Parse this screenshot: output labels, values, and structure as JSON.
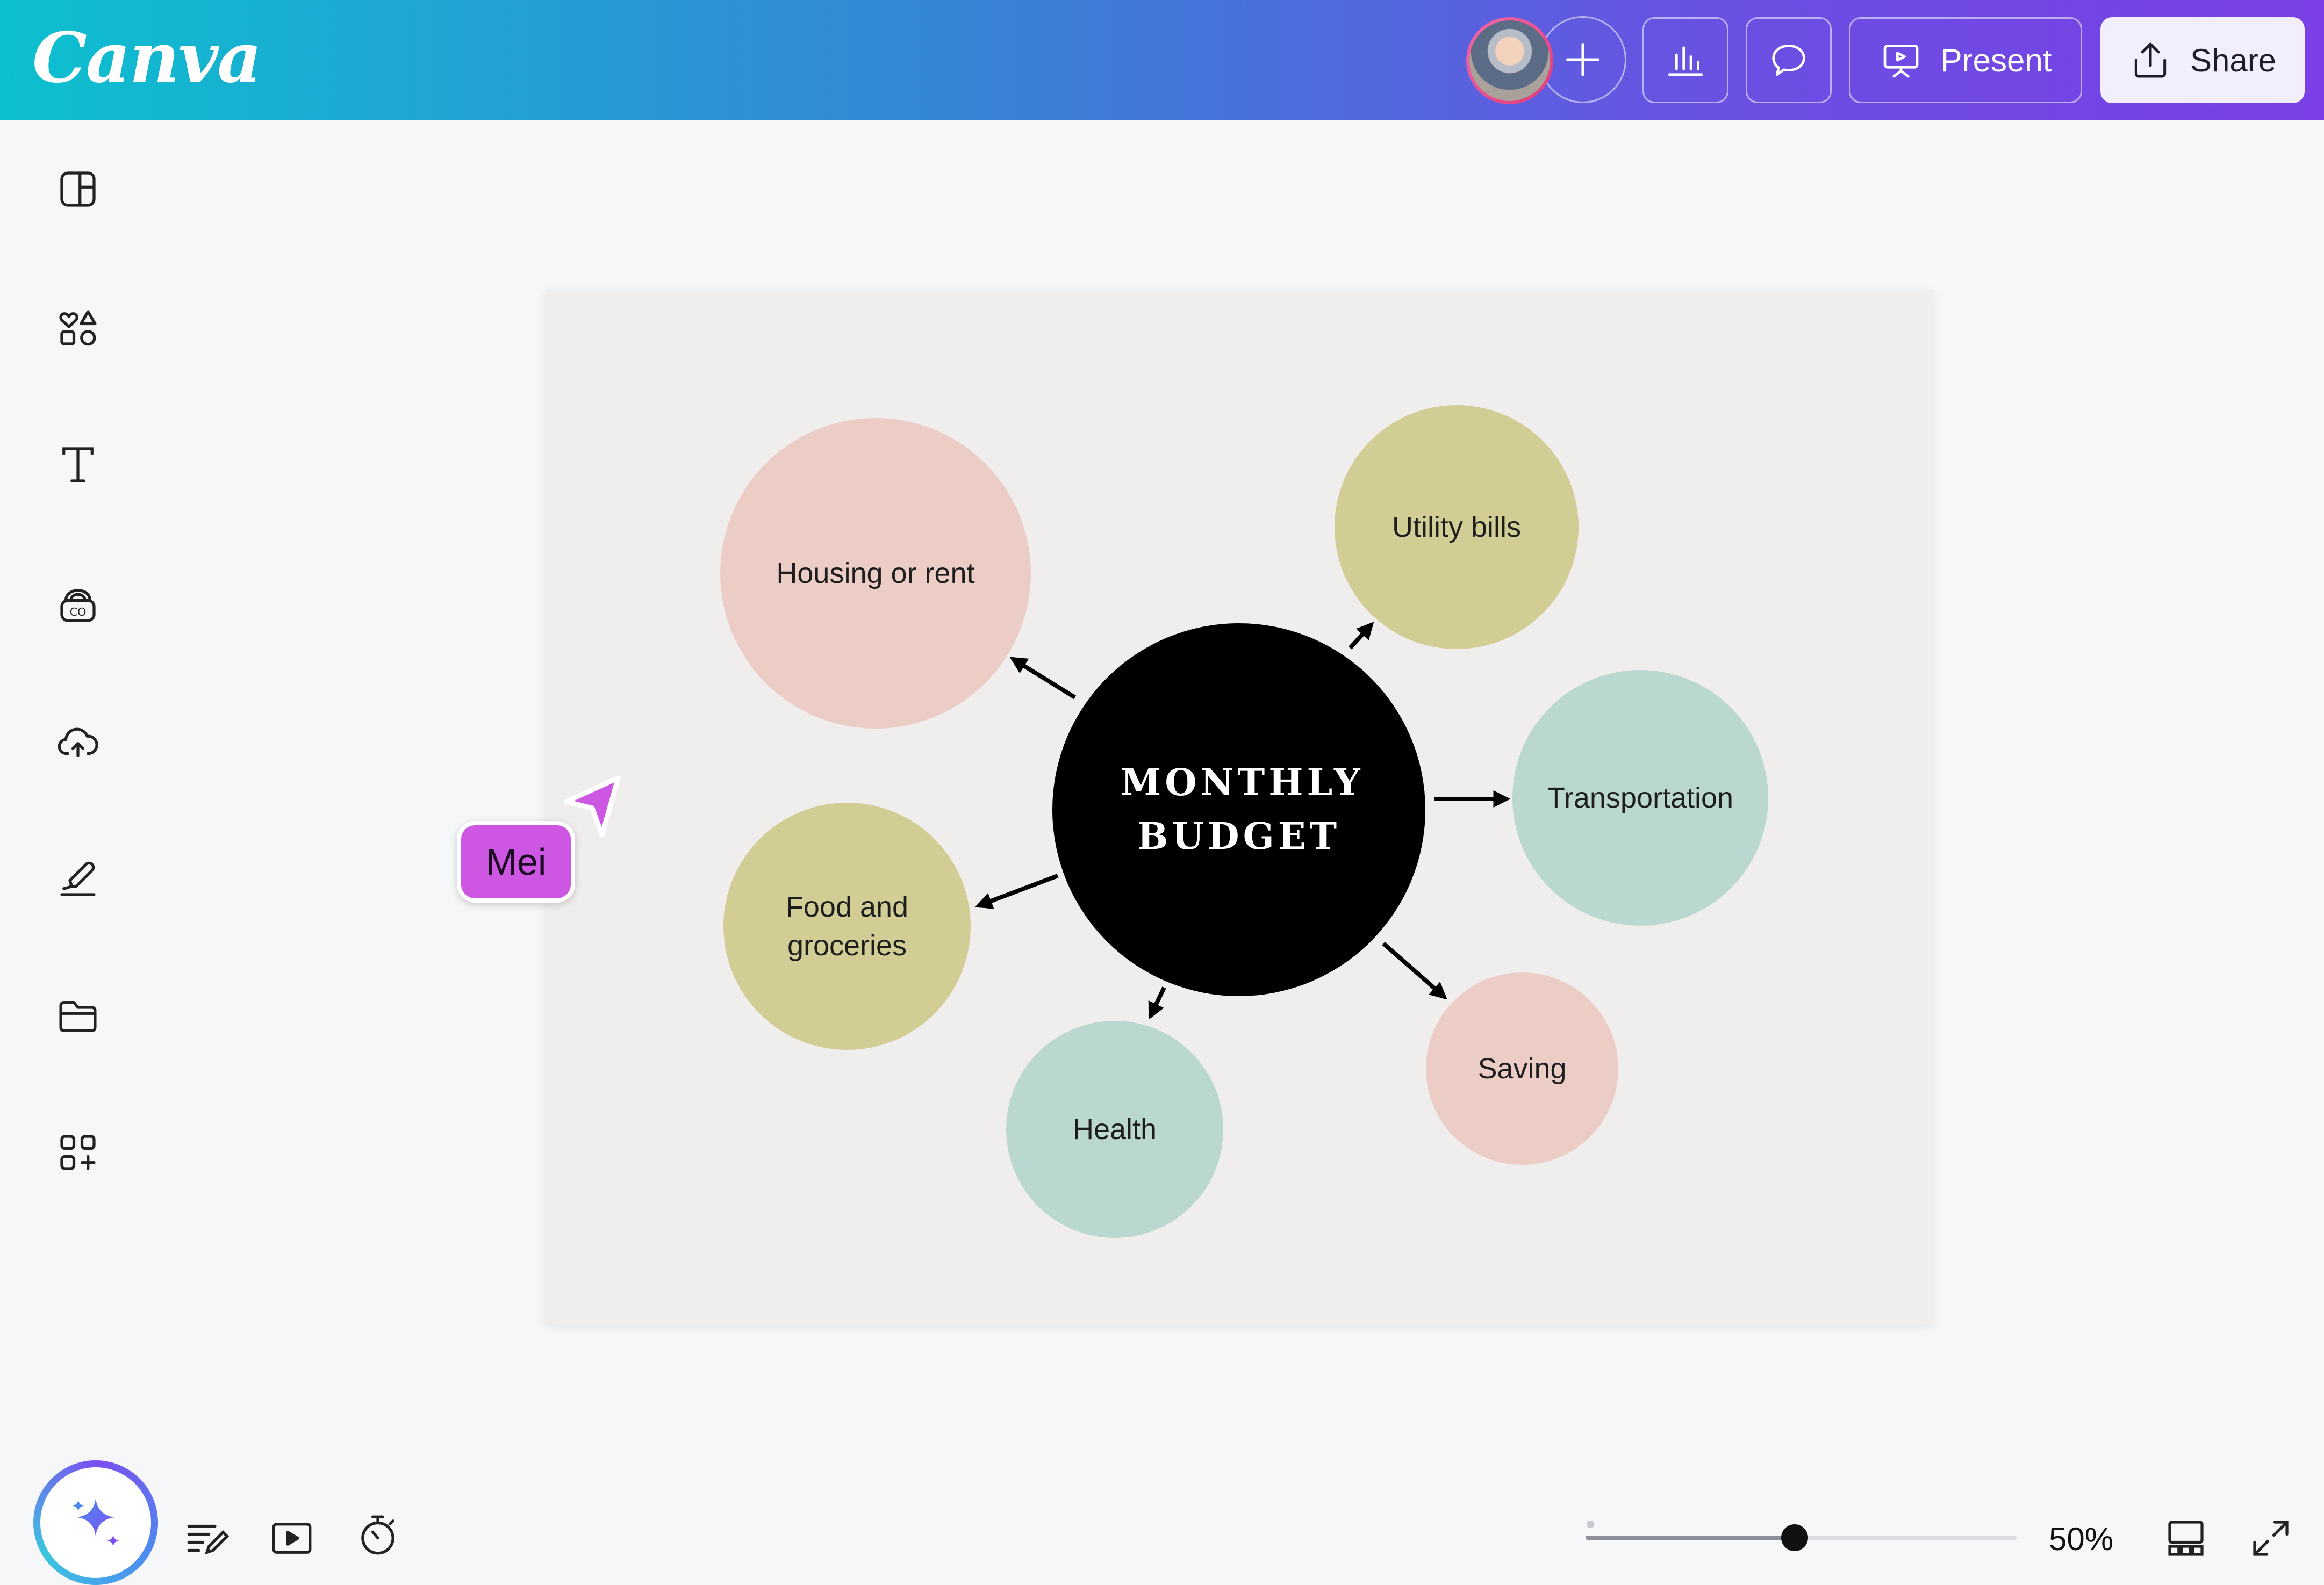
{
  "app": {
    "logo_text": "Canva"
  },
  "toolbar": {
    "present_label": "Present",
    "share_label": "Share",
    "icons": [
      "add-icon",
      "insights-icon",
      "comment-icon",
      "present-icon",
      "share-icon"
    ]
  },
  "sidebar": {
    "items": [
      "design-icon",
      "elements-icon",
      "text-icon",
      "brand-icon",
      "uploads-icon",
      "draw-icon",
      "projects-icon",
      "apps-icon"
    ]
  },
  "diagram": {
    "center": {
      "line1": "MONTHLY",
      "line2": "BUDGET",
      "color": "#000000"
    },
    "nodes": [
      {
        "line1": "Housing or rent",
        "line2": "",
        "color": "#eccdc5"
      },
      {
        "line1": "Utility bills",
        "line2": "",
        "color": "#d2cc95"
      },
      {
        "line1": "Transportation",
        "line2": "",
        "color": "#bad7d0"
      },
      {
        "line1": "Food and",
        "line2": "groceries",
        "color": "#d2cc95"
      },
      {
        "line1": "Health",
        "line2": "",
        "color": "#bad7d0"
      },
      {
        "line1": "Saving",
        "line2": "",
        "color": "#eccdc5"
      }
    ]
  },
  "collaborator": {
    "name": "Mei",
    "color": "#cd57e2"
  },
  "footer": {
    "zoom_value": 0.5,
    "zoom_label": "50%",
    "icons": [
      "notes-icon",
      "play-icon",
      "timer-icon",
      "grid-view-icon",
      "fullscreen-icon"
    ]
  },
  "colors": {
    "accent_gradient_start": "#0cc0cf",
    "accent_gradient_end": "#7a3fe6"
  }
}
